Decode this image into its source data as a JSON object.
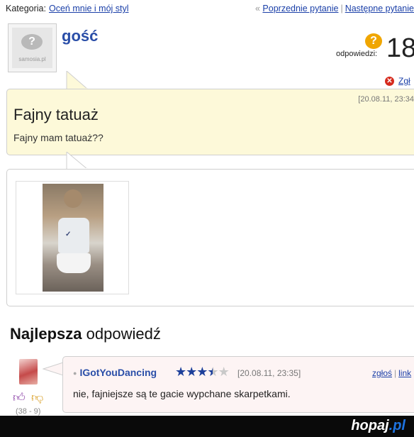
{
  "topbar": {
    "category_label": "Kategoria:",
    "category_link": "Oceń mnie i mój styl",
    "prev_label": "Poprzednie pytanie",
    "next_label": "Następne pytanie"
  },
  "question": {
    "avatar_text": "samosia.pl",
    "author": "gość",
    "answers_label": "odpowiedzi:",
    "answers_count": "18",
    "report_label": "Zgł",
    "date": "[20.08.11, 23:34",
    "title": "Fajny tatuaż",
    "body": "Fajny mam tatuaż??"
  },
  "best_answer": {
    "heading_bold": "Najlepsza",
    "heading_rest": "odpowiedź",
    "user": "IGotYouDancing",
    "rating_stars": 3.5,
    "date": "[20.08.11, 23:35]",
    "report_label": "zgłoś",
    "link_label": "link",
    "text": "nie, fajniejsze są te gacie wypchane skarpetkami.",
    "votes": "(38 - 9)"
  },
  "footer": {
    "brand_main": "hopaj",
    "brand_suffix": ".pl"
  },
  "colors": {
    "link": "#1a3fa8",
    "username": "#2a4ea8",
    "question_bg": "#fdf9d9",
    "answer_bg": "#fdf4f4",
    "answers_icon": "#f0a600",
    "report_icon": "#d62b1e"
  }
}
